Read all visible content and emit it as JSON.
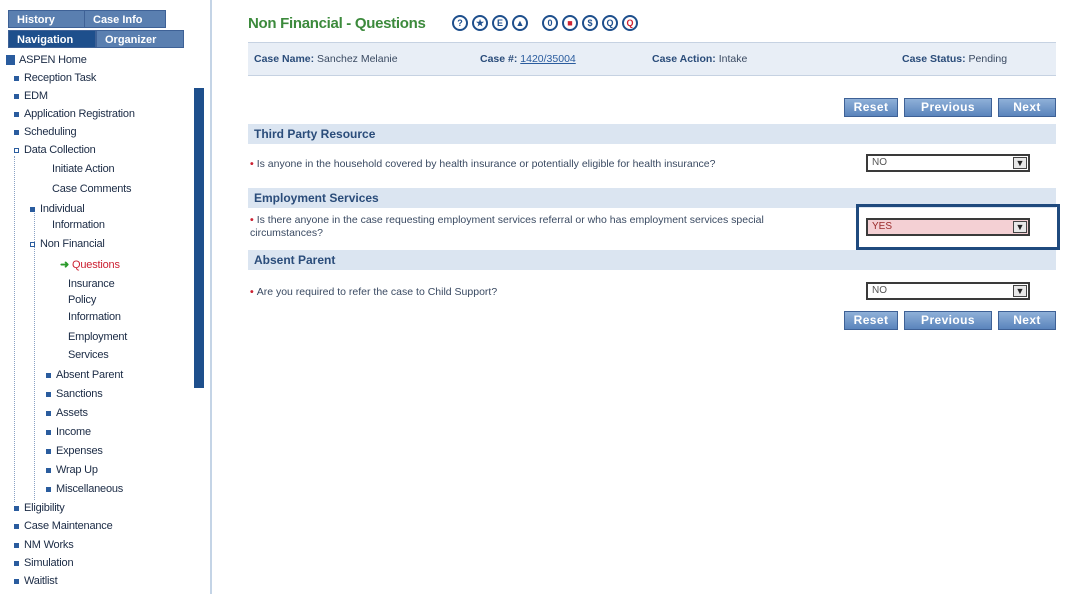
{
  "sidebar": {
    "tabs": {
      "history": "History",
      "case_info": "Case Info",
      "navigation": "Navigation",
      "organizer": "Organizer"
    },
    "items": {
      "aspen_home": "ASPEN Home",
      "reception_task": "Reception Task",
      "edm": "EDM",
      "application_registration": "Application Registration",
      "scheduling": "Scheduling",
      "data_collection": "Data Collection",
      "initiate_action": "Initiate Action",
      "case_comments": "Case Comments",
      "individual_1": "Individual",
      "individual_2": "Information",
      "non_financial": "Non Financial",
      "questions": "Questions",
      "insurance_1": "Insurance",
      "insurance_2": "Policy",
      "insurance_3": "Information",
      "employment_1": "Employment",
      "employment_2": "Services",
      "absent_parent": "Absent Parent",
      "sanctions": "Sanctions",
      "assets": "Assets",
      "income": "Income",
      "expenses": "Expenses",
      "wrap_up": "Wrap Up",
      "miscellaneous": "Miscellaneous",
      "eligibility": "Eligibility",
      "case_maintenance": "Case Maintenance",
      "nm_works": "NM Works",
      "simulation": "Simulation",
      "waitlist": "Waitlist"
    }
  },
  "header": {
    "title": "Non Financial - Questions",
    "icons": [
      "?",
      "★",
      "E",
      "▲",
      "0",
      "■",
      "$",
      "Q",
      "Q"
    ]
  },
  "case": {
    "name_label": "Case Name:",
    "name_value": "Sanchez Melanie",
    "number_label": "Case #:",
    "number_value": "1420/35004",
    "action_label": "Case Action:",
    "action_value": "Intake",
    "status_label": "Case Status:",
    "status_value": "Pending"
  },
  "buttons": {
    "reset": "Reset",
    "previous": "Previous",
    "next": "Next"
  },
  "sections": {
    "third_party": "Third Party Resource",
    "employment": "Employment Services",
    "absent_parent": "Absent Parent"
  },
  "questions": {
    "q1": "Is anyone in the household covered by health insurance or potentially eligible for health insurance?",
    "q1_value": "NO",
    "q2_line1": "Is there anyone in the case requesting employment services referral or who has employment services special",
    "q2_line2": "circumstances?",
    "q2_value": "YES",
    "q3": "Are you required to refer the case to Child Support?",
    "q3_value": "NO"
  },
  "required_marker": "•",
  "dropdown_glyph": "▼"
}
